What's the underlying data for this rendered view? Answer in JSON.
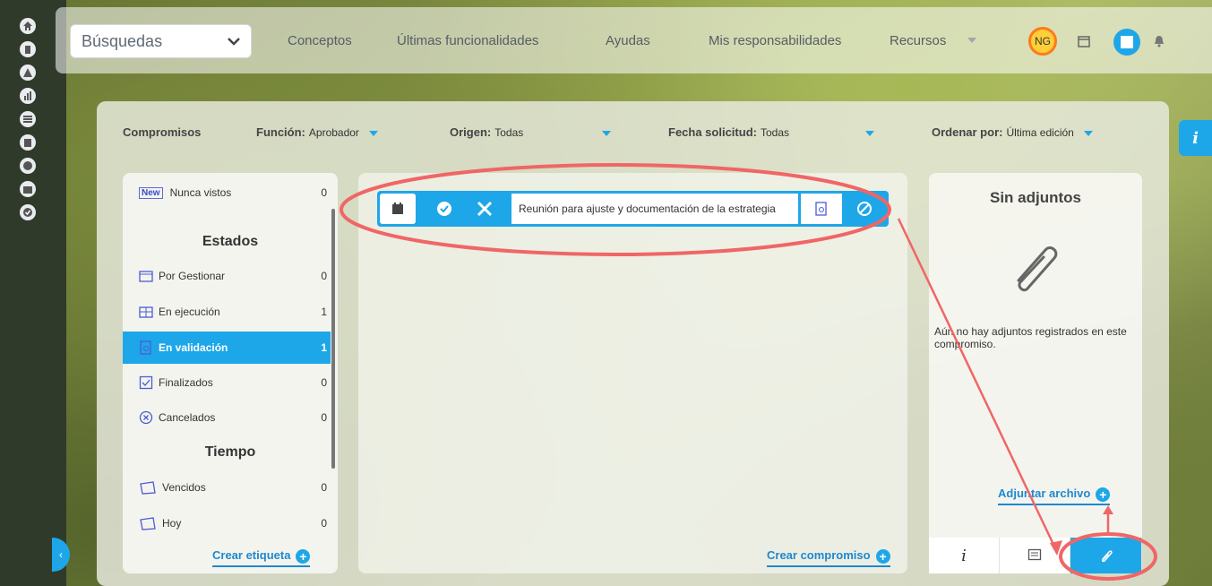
{
  "topbar": {
    "search_select": "Búsquedas",
    "nav": [
      "Conceptos",
      "Últimas funcionalidades",
      "Ayudas",
      "Mis responsabilidades",
      "Recursos"
    ],
    "avatar_initials": "NG"
  },
  "filters": {
    "title": "Compromisos",
    "funcion_label": "Función:",
    "funcion_value": "Aprobador",
    "origen_label": "Origen:",
    "origen_value": "Todas",
    "fecha_label": "Fecha solicitud:",
    "fecha_value": "Todas",
    "ordenar_label": "Ordenar por:",
    "ordenar_value": "Última edición"
  },
  "left": {
    "new_badge": "New",
    "nunca_vistos": "Nunca vistos",
    "nunca_vistos_count": "0",
    "estados_title": "Estados",
    "estados": [
      {
        "label": "Por Gestionar",
        "count": "0"
      },
      {
        "label": "En ejecución",
        "count": "1"
      },
      {
        "label": "En validación",
        "count": "1"
      },
      {
        "label": "Finalizados",
        "count": "0"
      },
      {
        "label": "Cancelados",
        "count": "0"
      }
    ],
    "tiempo_title": "Tiempo",
    "tiempo": [
      {
        "label": "Vencidos",
        "count": "0"
      },
      {
        "label": "Hoy",
        "count": "0"
      }
    ],
    "crear_etiqueta": "Crear etiqueta"
  },
  "center": {
    "task_title": "Reunión para ajuste y documentación de la estrategia",
    "crear_compromiso": "Crear compromiso"
  },
  "right": {
    "title": "Sin adjuntos",
    "empty_text": "Aún no hay adjuntos registrados en este compromiso.",
    "adjuntar": "Adjuntar archivo",
    "tab_info": "i"
  },
  "info_tab": "i",
  "colors": {
    "accent": "#1ea7e8",
    "annotation": "#f06666"
  }
}
